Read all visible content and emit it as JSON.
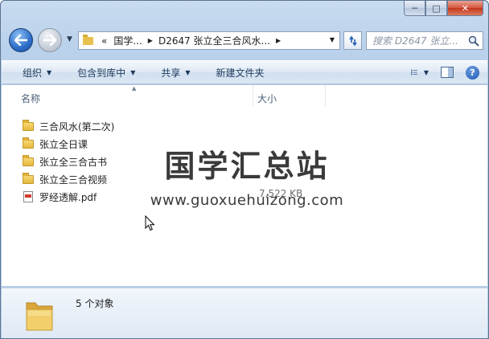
{
  "window": {
    "caption_buttons": {
      "minimize": "─",
      "maximize": "□",
      "close": "✕"
    }
  },
  "address_bar": {
    "overflow": "«",
    "parts": [
      "国学...",
      "D2647 张立全三合风水..."
    ],
    "search_placeholder": "搜索 D2647 张立..."
  },
  "toolbar": {
    "items": [
      {
        "label": "组织"
      },
      {
        "label": "包含到库中"
      },
      {
        "label": "共享"
      },
      {
        "label": "新建文件夹"
      }
    ]
  },
  "columns": {
    "name": "名称",
    "size": "大小"
  },
  "files": [
    {
      "name": "三合风水(第二次)",
      "type": "folder",
      "size": ""
    },
    {
      "name": "张立全日课",
      "type": "folder",
      "size": ""
    },
    {
      "name": "张立全三合古书",
      "type": "folder",
      "size": ""
    },
    {
      "name": "张立全三合视频",
      "type": "folder",
      "size": ""
    },
    {
      "name": "罗经透解.pdf",
      "type": "pdf",
      "size": "7,522 KB"
    }
  ],
  "watermark": {
    "title": "国学汇总站",
    "url": "www.guoxuehuizong.com"
  },
  "status": {
    "count_text": "5 个对象"
  },
  "colors": {
    "accent": "#2b6cc8",
    "folder": "#e5b83d",
    "toolbar_text": "#1e395b"
  }
}
